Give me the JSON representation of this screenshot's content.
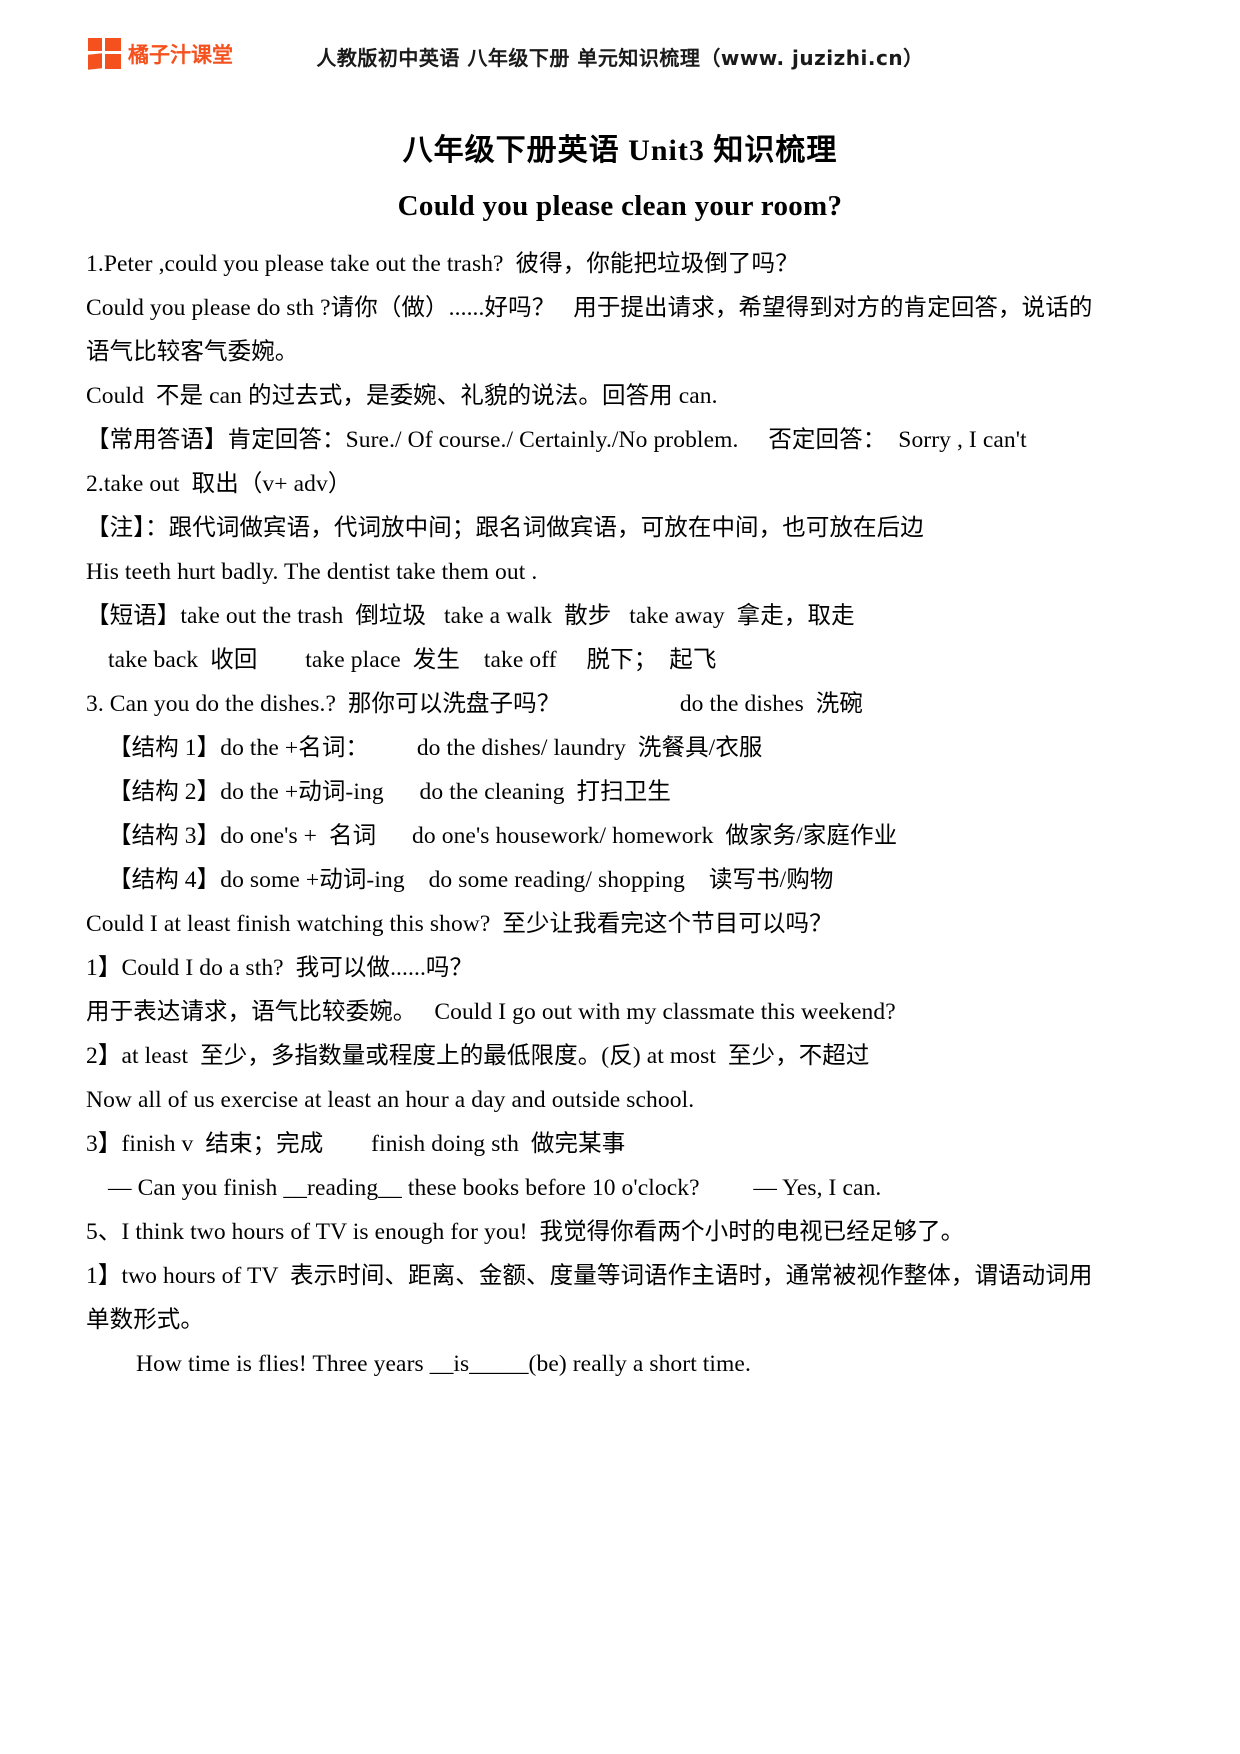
{
  "header": {
    "brand_name": "橘子汁课堂",
    "title": "人教版初中英语 八年级下册 单元知识梳理（www. juzizhi.cn）",
    "brand_color": "#F4511E"
  },
  "document": {
    "title_cn": "八年级下册英语 Unit3 知识梳理",
    "title_en": "Could you please clean your room?"
  },
  "body": {
    "lines": [
      {
        "text": "1.Peter ,could you please take out the trash?  彼得，你能把垃圾倒了吗？",
        "indent": 0
      },
      {
        "text": "Could you please do sth ?请你（做）......好吗？   用于提出请求，希望得到对方的肯定回答，说话的",
        "indent": 0
      },
      {
        "text": "语气比较客气委婉。",
        "indent": 0
      },
      {
        "text": "Could  不是 can 的过去式，是委婉、礼貌的说法。回答用 can.",
        "indent": 0
      },
      {
        "text": "【常用答语】肯定回答：Sure./ Of course./ Certainly./No problem.     否定回答：  Sorry , I can't",
        "indent": 0
      },
      {
        "text": "2.take out  取出（v+ adv）",
        "indent": 0
      },
      {
        "text": "【注】：跟代词做宾语，代词放中间；跟名词做宾语，可放在中间，也可放在后边",
        "indent": 0
      },
      {
        "text": "His teeth hurt badly. The dentist take them out .",
        "indent": 0
      },
      {
        "text": "【短语】take out the trash  倒垃圾   take a walk  散步   take away  拿走，取走",
        "indent": 0
      },
      {
        "text": "take back  收回        take place  发生    take off     脱下；  起飞",
        "indent": 1
      },
      {
        "text": "3. Can you do the dishes.?  那你可以洗盘子吗？                    do the dishes  洗碗",
        "indent": 0
      },
      {
        "text": "【结构 1】do the +名词：        do the dishes/ laundry  洗餐具/衣服",
        "indent": 1
      },
      {
        "text": "【结构 2】do the +动词-ing      do the cleaning  打扫卫生",
        "indent": 1
      },
      {
        "text": "【结构 3】do one's +  名词      do one's housework/ homework  做家务/家庭作业",
        "indent": 1
      },
      {
        "text": "【结构 4】do some +动词-ing    do some reading/ shopping    读写书/购物",
        "indent": 1
      },
      {
        "text": "Could I at least finish watching this show?  至少让我看完这个节目可以吗？",
        "indent": 0
      },
      {
        "text": "1】Could I do a sth?  我可以做......吗？",
        "indent": 0
      },
      {
        "text": "用于表达请求，语气比较委婉。   Could I go out with my classmate this weekend?",
        "indent": 0
      },
      {
        "text": "2】at least  至少，多指数量或程度上的最低限度。(反) at most  至少，不超过",
        "indent": 0
      },
      {
        "text": "Now all of us exercise at least an hour a day and outside school.",
        "indent": 0
      },
      {
        "text": "3】finish v  结束；完成        finish doing sth  做完某事",
        "indent": 0
      },
      {
        "text": "— Can you finish __reading__ these books before 10 o'clock?         — Yes, I can.",
        "indent": 1
      },
      {
        "text": "5、I think two hours of TV is enough for you!  我觉得你看两个小时的电视已经足够了。",
        "indent": 0
      },
      {
        "text": "1】two hours of TV  表示时间、距离、金额、度量等词语作主语时，通常被视作整体，谓语动词用",
        "indent": 0
      },
      {
        "text": "单数形式。",
        "indent": 0
      },
      {
        "text": "How time is flies! Three years __is_____(be) really a short time.",
        "indent": 2
      }
    ]
  }
}
